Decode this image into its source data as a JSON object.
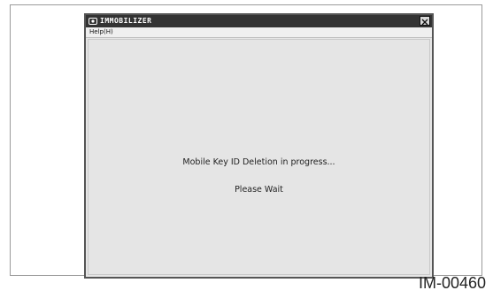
{
  "window": {
    "title": "IMMOBILIZER",
    "app_icon": "app-logo-icon",
    "close_icon": "close-icon"
  },
  "menubar": {
    "items": [
      {
        "label": "Help(H)"
      }
    ]
  },
  "content": {
    "progress_message": "Mobile Key ID Deletion in progress...",
    "wait_message": "Please Wait"
  },
  "figure": {
    "id": "IM-00460"
  }
}
